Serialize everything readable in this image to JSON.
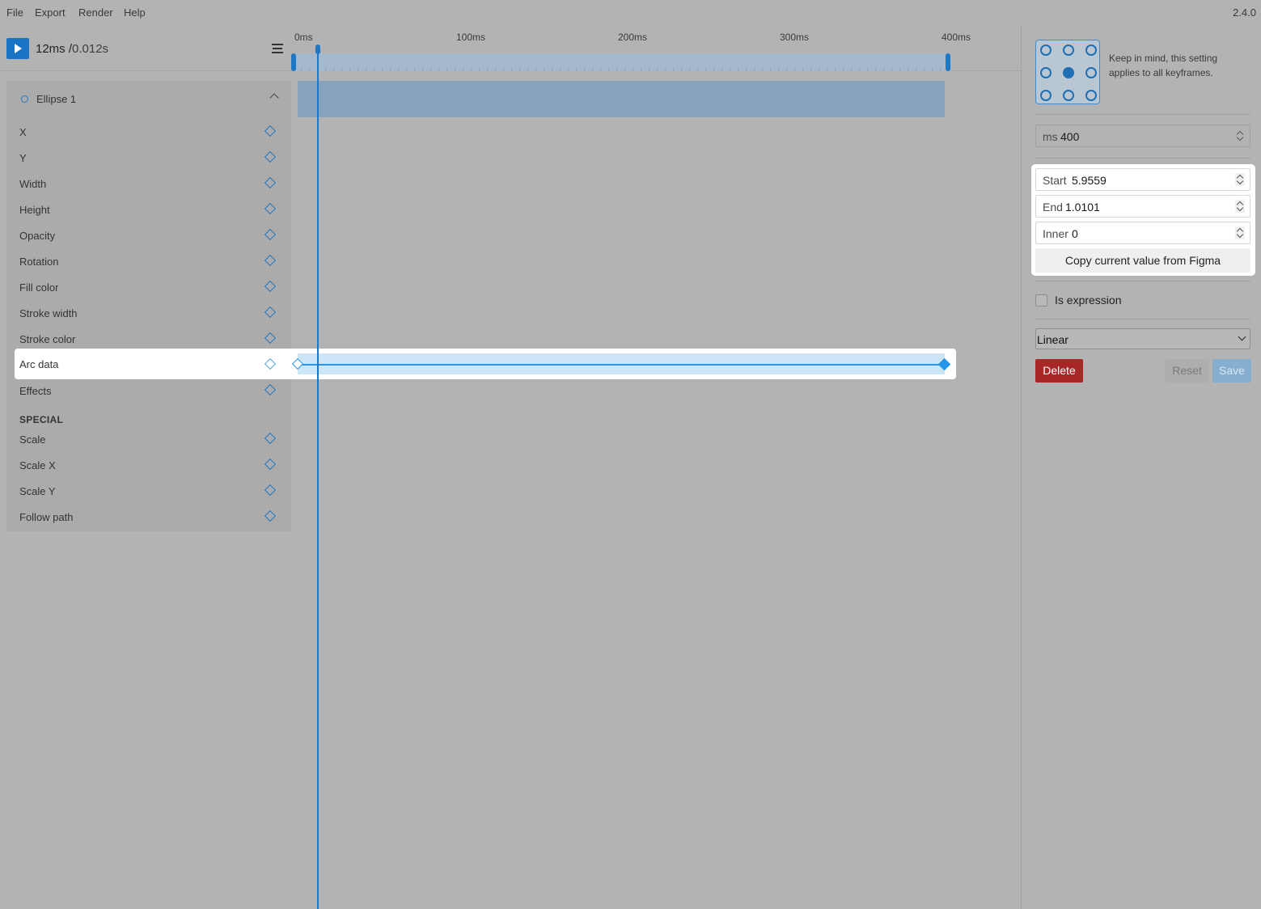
{
  "menu": {
    "items": [
      "File",
      "Export",
      "Render",
      "Help"
    ],
    "version": "2.4.0"
  },
  "transport": {
    "time_ms": "12ms /",
    "time_s": "0.012s",
    "play_icon": "play-icon",
    "menu_icon": "hamburger-icon"
  },
  "ruler": {
    "ticks": [
      "0ms",
      "100ms",
      "200ms",
      "300ms",
      "400ms"
    ],
    "duration_ms": 400,
    "playhead_ms": 12
  },
  "layer": {
    "name": "Ellipse 1",
    "properties": [
      "X",
      "Y",
      "Width",
      "Height",
      "Opacity",
      "Rotation",
      "Fill color",
      "Stroke width",
      "Stroke color",
      "Arc data",
      "Effects"
    ],
    "selected_property": "Arc data",
    "special_label": "SPECIAL",
    "special_properties": [
      "Scale",
      "Scale X",
      "Scale Y",
      "Follow path"
    ]
  },
  "inspector": {
    "anchor_note": "Keep in mind, this setting applies to all keyframes.",
    "anchor_selected": "center",
    "ms_field": {
      "label": "ms",
      "value": "400"
    },
    "start_field": {
      "label": "Start",
      "value": "5.9559"
    },
    "end_field": {
      "label": "End",
      "value": "1.0101"
    },
    "inner_field": {
      "label": "Inner",
      "value": "0"
    },
    "copy_button": "Copy current value from Figma",
    "expression_label": "Is expression",
    "easing": "Linear",
    "delete_label": "Delete",
    "reset_label": "Reset",
    "save_label": "Save"
  },
  "colors": {
    "accent": "#1f78c4",
    "danger": "#a82626",
    "background": "#b3b3b3"
  }
}
